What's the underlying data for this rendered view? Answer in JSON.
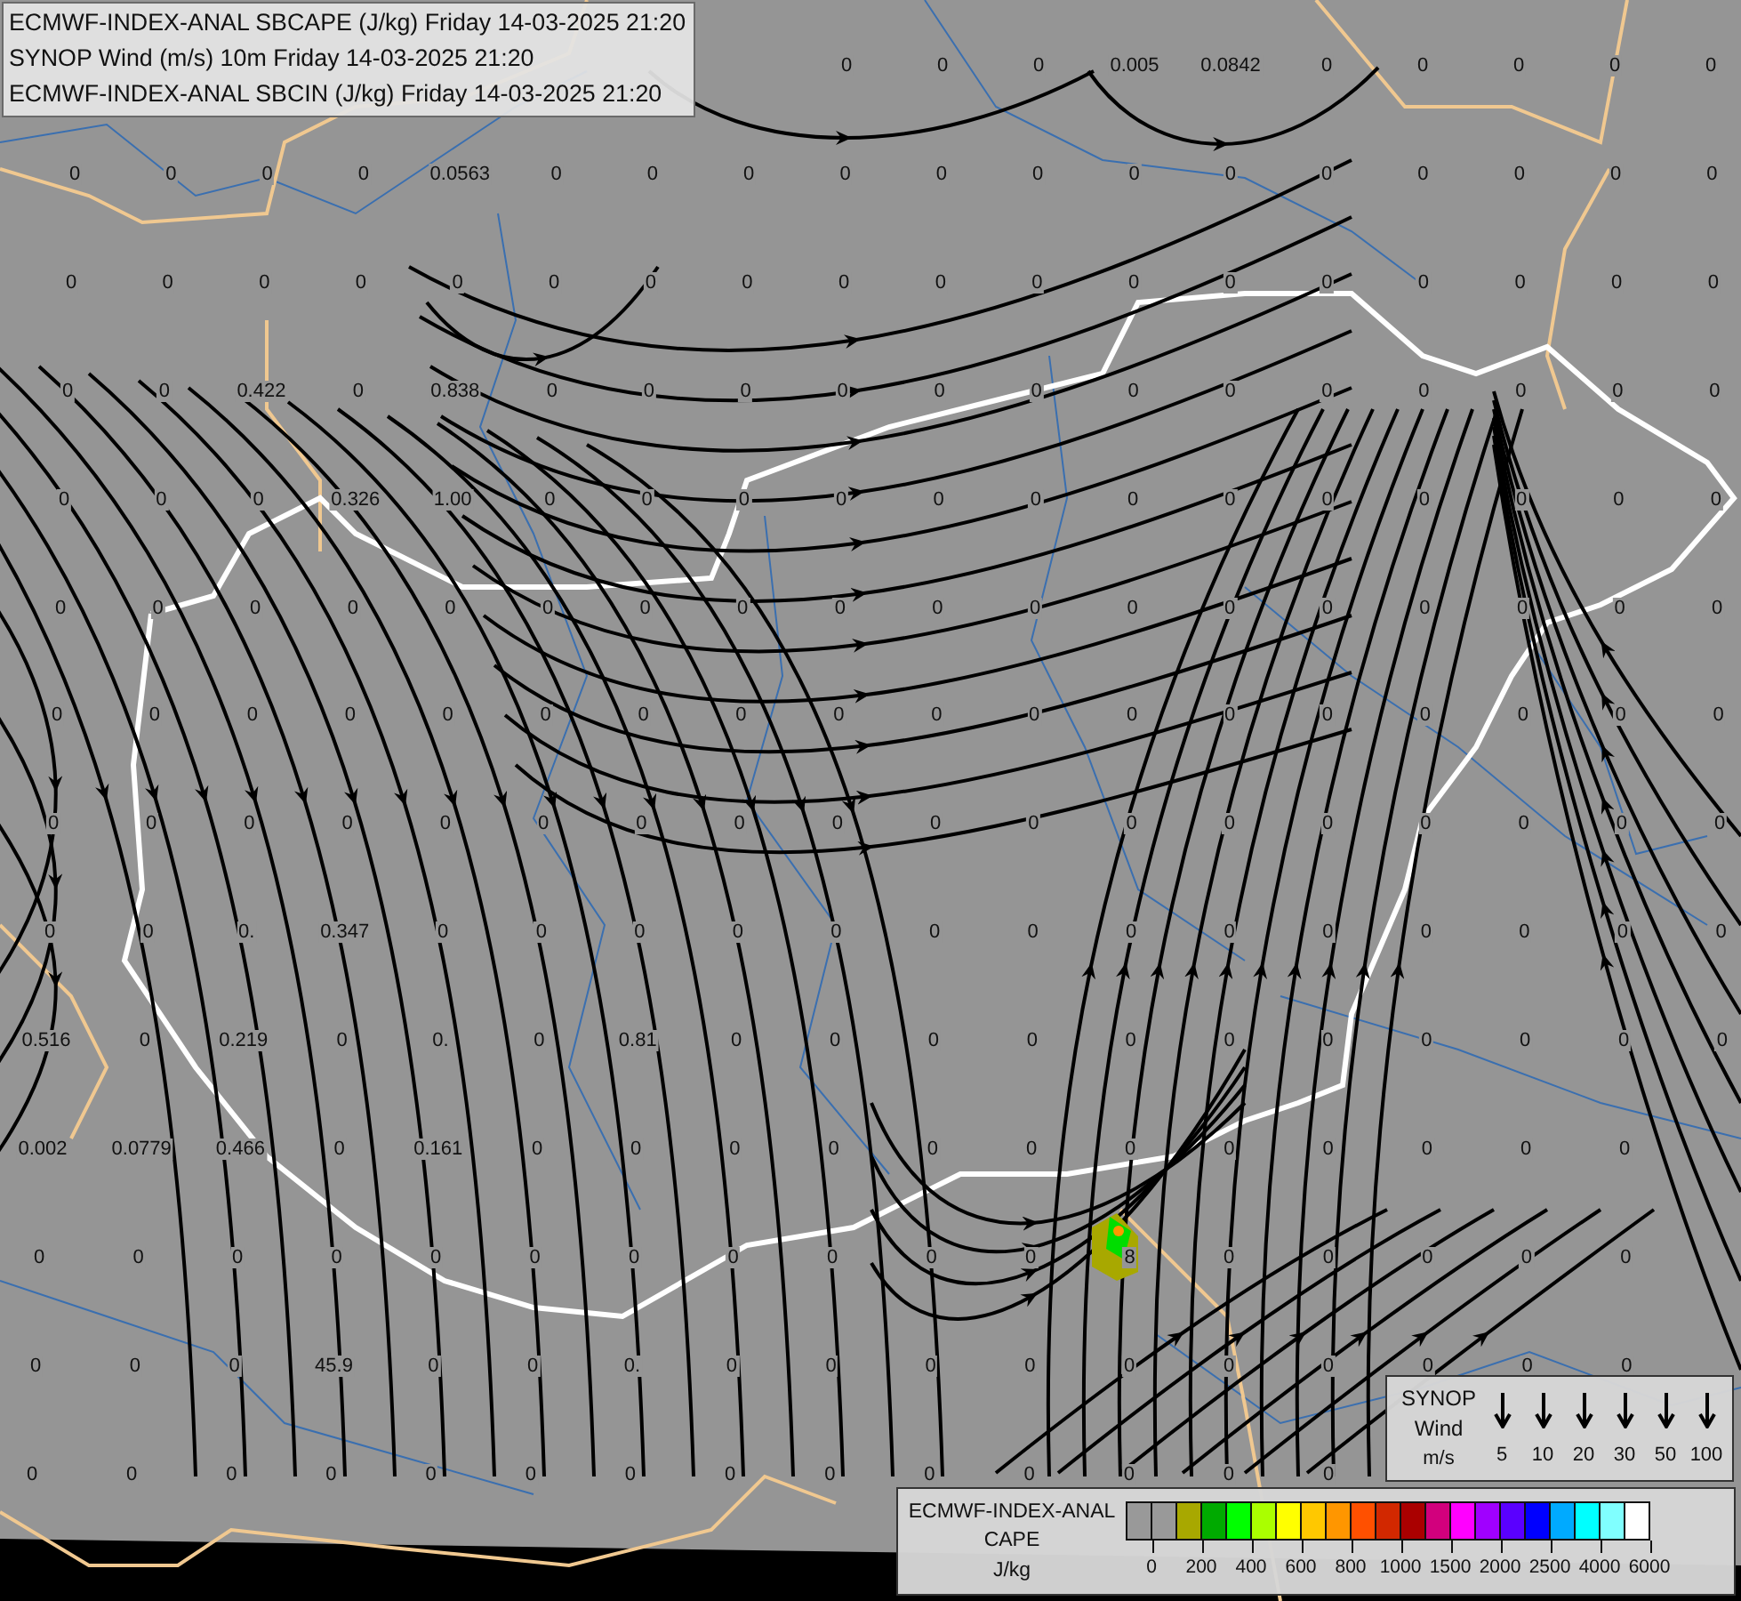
{
  "header": {
    "lines": [
      "ECMWF-INDEX-ANAL SBCAPE (J/kg) Friday 14-03-2025 21:20",
      "SYNOP Wind (m/s) 10m Friday 14-03-2025 21:20",
      "ECMWF-INDEX-ANAL SBCIN (J/kg) Friday 14-03-2025 21:20"
    ]
  },
  "map": {
    "value_rows": [
      {
        "values": [
          "0",
          "0",
          "0",
          "0.005",
          "0.0842",
          "0",
          "0",
          "0",
          "0",
          "0"
        ]
      },
      {
        "values": [
          "0",
          "0",
          "0",
          "0",
          "0.0563",
          "0",
          "0",
          "0",
          "0",
          "0",
          "0",
          "0",
          "0",
          "0",
          "0",
          "0",
          "0",
          "0"
        ]
      },
      {
        "values": [
          "0",
          "0",
          "0",
          "0",
          "0",
          "0",
          "0",
          "0",
          "0",
          "0",
          "0",
          "0",
          "0",
          "0",
          "0",
          "0",
          "0",
          "0"
        ]
      },
      {
        "values": [
          "0",
          "0",
          "0.422",
          "0",
          "0.838",
          "0",
          "0",
          "0",
          "0",
          "0",
          "0",
          "0",
          "0",
          "0",
          "0",
          "0",
          "0",
          "0"
        ]
      },
      {
        "values": [
          "0",
          "0",
          "0",
          "0.326",
          "1.00",
          "0",
          "0",
          "0",
          "0",
          "0",
          "0",
          "0",
          "0",
          "0",
          "0",
          "0",
          "0",
          "0"
        ]
      },
      {
        "values": [
          "0",
          "0",
          "0",
          "0",
          "0",
          "0",
          "0",
          "0",
          "0",
          "0",
          "0",
          "0",
          "0",
          "0",
          "0",
          "0",
          "0",
          "0"
        ]
      },
      {
        "values": [
          "0",
          "0",
          "0",
          "0",
          "0",
          "0",
          "0",
          "0",
          "0",
          "0",
          "0",
          "0",
          "0",
          "0",
          "0",
          "0",
          "0",
          "0"
        ]
      },
      {
        "values": [
          "0",
          "0",
          "0",
          "0",
          "0",
          "0",
          "0",
          "0",
          "0",
          "0",
          "0",
          "0",
          "0",
          "0",
          "0",
          "0",
          "0",
          "0"
        ]
      },
      {
        "values": [
          "0",
          "0",
          "0.",
          "0.347",
          "0",
          "0",
          "0",
          "0",
          "0",
          "0",
          "0",
          "0",
          "0",
          "0",
          "0",
          "0",
          "0",
          "0"
        ]
      },
      {
        "values": [
          "0.516",
          "0",
          "0.219",
          "0",
          "0.",
          "0",
          "0.81",
          "0",
          "0",
          "0",
          "0",
          "0",
          "0",
          "0",
          "0",
          "0",
          "0",
          "0"
        ]
      },
      {
        "values": [
          "0.002",
          "0.0779",
          "0.466",
          "0",
          "0.161",
          "0",
          "0",
          "0",
          "0",
          "0",
          "0",
          "0",
          "0",
          "0",
          "0",
          "0",
          "0"
        ]
      },
      {
        "values": [
          "0",
          "0",
          "0",
          "0",
          "0",
          "0",
          "0",
          "0",
          "0",
          "0",
          "0",
          "8",
          "0",
          "0",
          "0",
          "0",
          "0"
        ]
      },
      {
        "values": [
          "0",
          "0",
          "0",
          "45.9",
          "0",
          "0",
          "0.",
          "0",
          "0",
          "0",
          "0",
          "0",
          "0",
          "0",
          "0",
          "0",
          "0"
        ]
      },
      {
        "values": [
          "0",
          "0",
          "0",
          "0",
          "0",
          "0",
          "0",
          "0",
          "0",
          "0",
          "0",
          "0",
          "0",
          "0"
        ]
      }
    ]
  },
  "wind_legend": {
    "title_lines": [
      "SYNOP",
      "Wind",
      "m/s"
    ],
    "speeds": [
      "5",
      "10",
      "20",
      "30",
      "50",
      "100"
    ]
  },
  "cape_legend": {
    "title_lines": [
      "ECMWF-INDEX-ANAL",
      "CAPE",
      "J/kg"
    ],
    "swatches": [
      {
        "color": "#999999"
      },
      {
        "color": "#999999"
      },
      {
        "color": "#a8a800"
      },
      {
        "color": "#00aa00"
      },
      {
        "color": "#00ff00"
      },
      {
        "color": "#aaff00"
      },
      {
        "color": "#ffff00"
      },
      {
        "color": "#ffc800"
      },
      {
        "color": "#ff9600"
      },
      {
        "color": "#ff5000"
      },
      {
        "color": "#d22800"
      },
      {
        "color": "#aa0000"
      },
      {
        "color": "#d2007d"
      },
      {
        "color": "#ff00ff"
      },
      {
        "color": "#a000ff"
      },
      {
        "color": "#5a00ff"
      },
      {
        "color": "#0000ff"
      },
      {
        "color": "#00aaff"
      },
      {
        "color": "#00ffff"
      },
      {
        "color": "#80ffff"
      },
      {
        "color": "#ffffff"
      }
    ],
    "ticks": [
      "0",
      "200",
      "400",
      "600",
      "800",
      "1000",
      "1500",
      "2000",
      "2500",
      "4000",
      "6000"
    ]
  }
}
